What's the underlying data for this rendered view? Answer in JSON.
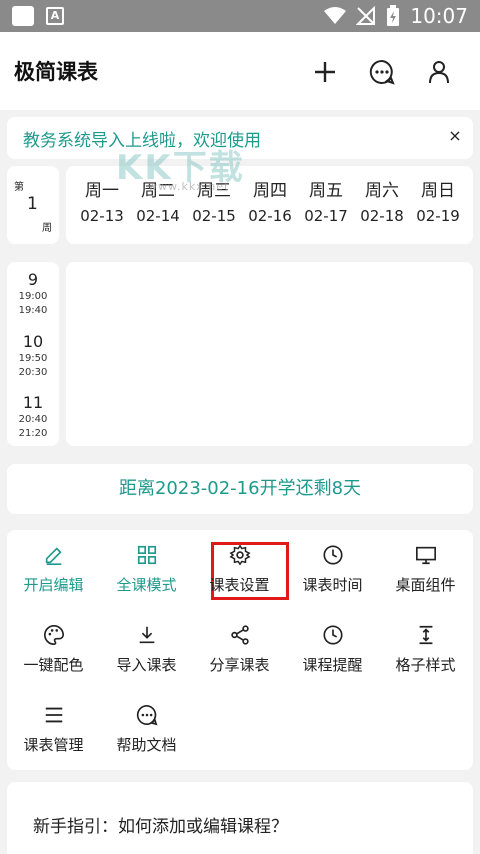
{
  "status_bar": {
    "time": "10:07"
  },
  "header": {
    "title": "极简课表"
  },
  "notice": {
    "text": "教务系统导入上线啦，欢迎使用",
    "close": "×"
  },
  "week": {
    "di": "第",
    "number": "1",
    "zhou": "周"
  },
  "days": [
    {
      "name": "周一",
      "date": "02-13"
    },
    {
      "name": "周二",
      "date": "02-14"
    },
    {
      "name": "周三",
      "date": "02-15"
    },
    {
      "name": "周四",
      "date": "02-16"
    },
    {
      "name": "周五",
      "date": "02-17"
    },
    {
      "name": "周六",
      "date": "02-18"
    },
    {
      "name": "周日",
      "date": "02-19"
    }
  ],
  "periods": [
    {
      "num": "9",
      "start": "19:00",
      "end": "19:40"
    },
    {
      "num": "10",
      "start": "19:50",
      "end": "20:30"
    },
    {
      "num": "11",
      "start": "20:40",
      "end": "21:20"
    }
  ],
  "watermark": {
    "text": "KK下载",
    "url": "www.kkx.net"
  },
  "countdown": {
    "text": "距离2023-02-16开学还剩8天"
  },
  "menu": [
    {
      "label": "开启编辑",
      "icon": "pencil-icon"
    },
    {
      "label": "全课模式",
      "icon": "grid-icon"
    },
    {
      "label": "课表设置",
      "icon": "gear-icon"
    },
    {
      "label": "课表时间",
      "icon": "clock-icon"
    },
    {
      "label": "桌面组件",
      "icon": "monitor-icon"
    },
    {
      "label": "一键配色",
      "icon": "palette-icon"
    },
    {
      "label": "导入课表",
      "icon": "download-icon"
    },
    {
      "label": "分享课表",
      "icon": "share-icon"
    },
    {
      "label": "课程提醒",
      "icon": "clock-icon"
    },
    {
      "label": "格子样式",
      "icon": "height-icon"
    },
    {
      "label": "课表管理",
      "icon": "list-icon"
    },
    {
      "label": "帮助文档",
      "icon": "chat-icon"
    }
  ],
  "guide": {
    "text": "新手指引：如何添加或编辑课程？"
  },
  "colors": {
    "accent": "#1e9a8c",
    "highlight": "#e01818"
  }
}
